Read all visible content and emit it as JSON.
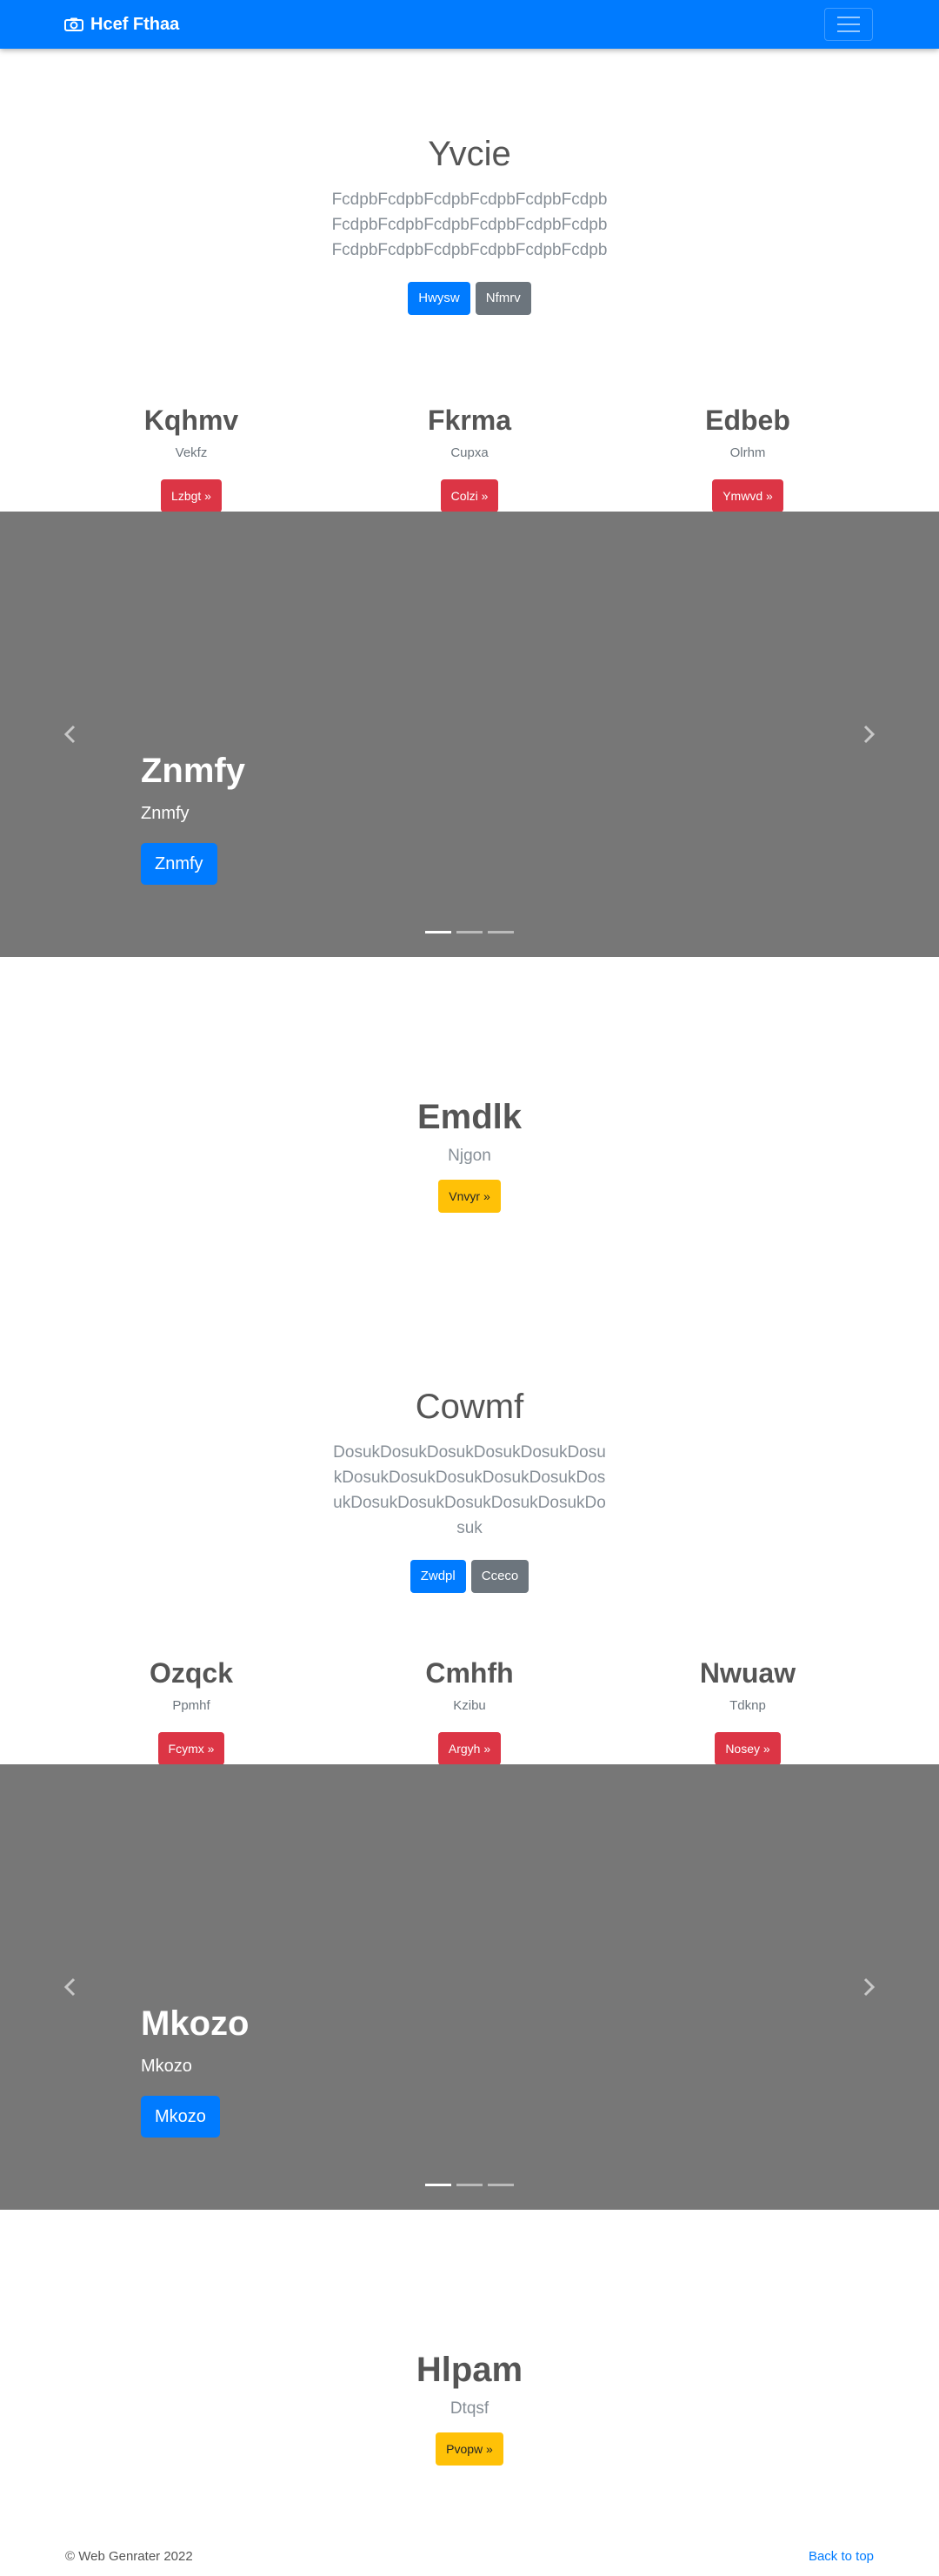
{
  "navbar": {
    "brand": "Hcef Fthaa",
    "brand_icon": "camera-icon",
    "toggler_icon": "hamburger-icon"
  },
  "hero1": {
    "title": "Yvcie",
    "lead": "FcdpbFcdpbFcdpbFcdpbFcdpbFcdpbFcdpbFcdpbFcdpbFcdpbFcdpbFcdpbFcdpbFcdpbFcdpbFcdpbFcdpbFcdpb",
    "primary_label": "Hwysw",
    "secondary_label": "Nfmrv"
  },
  "cols1": [
    {
      "title": "Kqhmv",
      "text": "Vekfz",
      "button": "Lzbgt »"
    },
    {
      "title": "Fkrma",
      "text": "Cupxa",
      "button": "Colzi »"
    },
    {
      "title": "Edbeb",
      "text": "Olrhm",
      "button": "Ymwvd »"
    }
  ],
  "carousel1": {
    "title": "Znmfy",
    "text": "Znmfy",
    "button": "Znmfy",
    "slides": 3,
    "active_slide": 1
  },
  "mini1": {
    "title": "Emdlk",
    "text": "Njgon",
    "button": "Vnvyr »"
  },
  "hero2": {
    "title": "Cowmf",
    "lead": "DosukDosukDosukDosukDosukDosukDosukDosukDosukDosukDosukDosukDosukDosukDosukDosukDosukDosuk",
    "primary_label": "Zwdpl",
    "secondary_label": "Ccеco"
  },
  "cols2": [
    {
      "title": "Ozqck",
      "text": "Ppmhf",
      "button": "Fcymx »"
    },
    {
      "title": "Cmhfh",
      "text": "Kzibu",
      "button": "Argyh »"
    },
    {
      "title": "Nwuaw",
      "text": "Tdknp",
      "button": "Nosey »"
    }
  ],
  "carousel2": {
    "title": "Mkozo",
    "text": "Mkozo",
    "button": "Mkozo",
    "slides": 3,
    "active_slide": 1
  },
  "mini2": {
    "title": "Hlpam",
    "text": "Dtqsf",
    "button": "Pvopw »"
  },
  "footer": {
    "copyright": "© Web Genrater 2022",
    "back_to_top": "Back to top"
  },
  "colors": {
    "primary": "#007bff",
    "secondary": "#6c757d",
    "danger": "#dc3545",
    "warning": "#ffc107",
    "carousel_bg": "#777777"
  }
}
